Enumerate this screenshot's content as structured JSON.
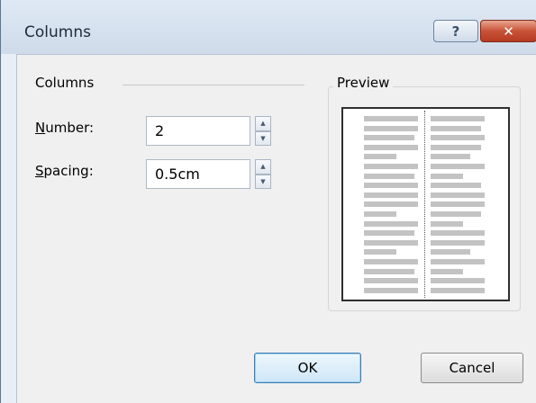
{
  "window": {
    "title": "Columns",
    "help_glyph": "?",
    "close_glyph": "✕"
  },
  "columns_group": {
    "label": "Columns",
    "number": {
      "label_mnemonic": "N",
      "label_rest": "umber:",
      "value": "2"
    },
    "spacing": {
      "label_mnemonic": "S",
      "label_rest": "pacing:",
      "value": "0.5cm"
    }
  },
  "preview": {
    "label": "Preview",
    "column_count": 2,
    "left_line_fractions": [
      1,
      1,
      0.93,
      1,
      0.6,
      1,
      0.93,
      1,
      1,
      1,
      0.6,
      1,
      0.93,
      1,
      0.6,
      1,
      0.93,
      1,
      1
    ],
    "right_line_fractions": [
      1,
      0.93,
      1,
      0.93,
      0.73,
      1,
      0.6,
      0.93,
      1,
      1,
      0.93,
      0.6,
      1,
      1,
      0.73,
      1,
      0.6,
      1,
      1
    ]
  },
  "buttons": {
    "ok": "OK",
    "cancel": "Cancel"
  }
}
